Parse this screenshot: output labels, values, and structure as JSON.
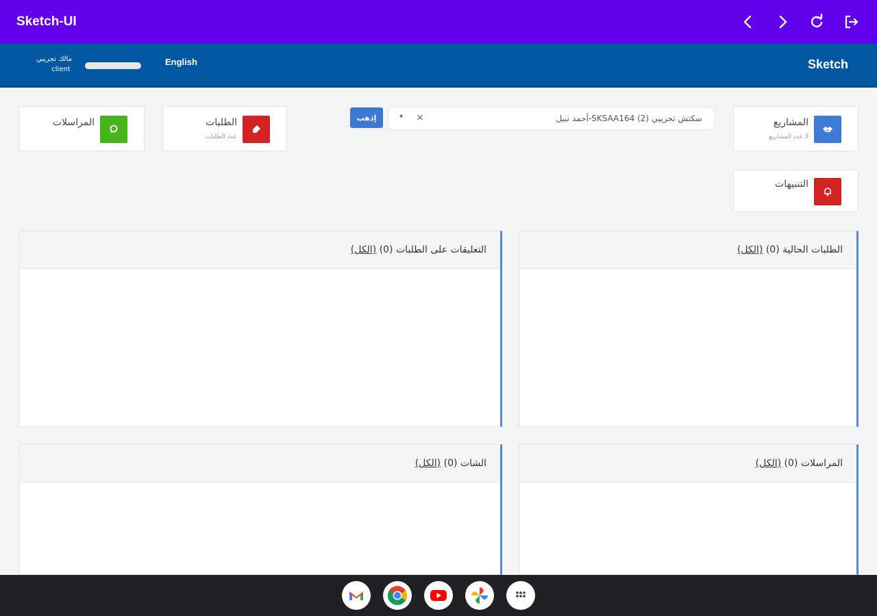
{
  "appbar": {
    "title": "Sketch-UI",
    "actions": [
      {
        "name": "back-button",
        "icon": "chevron-left-icon"
      },
      {
        "name": "forward-button",
        "icon": "chevron-right-icon"
      },
      {
        "name": "reload-button",
        "icon": "refresh-icon"
      },
      {
        "name": "logout-button",
        "icon": "logout-icon"
      }
    ],
    "colors": {
      "background": "#6200ee"
    }
  },
  "header": {
    "brand": "Sketch",
    "language_link": "English",
    "user": {
      "name": "مالك تجريبي",
      "role": "client"
    },
    "colors": {
      "background": "#0158a0"
    }
  },
  "cards": {
    "projects": {
      "label": "المشاريع",
      "sub": "لا عدد المشاريع",
      "icon": "handshake-icon",
      "color": "#3e7bd6"
    },
    "requests": {
      "label": "الطلبات",
      "sub": "عدد الطلبات",
      "icon": "tag-icon",
      "color": "#d32224"
    },
    "messages": {
      "label": "المراسلات",
      "sub": "",
      "icon": "chat-bubble-icon",
      "color": "#46b41a"
    },
    "alerts": {
      "label": "التنبيهات",
      "sub": "",
      "icon": "bell-icon",
      "color": "#d32224"
    }
  },
  "project_select": {
    "value": "سكتش تجريبي (2) SKSAA164-أحمد نبيل",
    "clear_symbol": "×",
    "arrow_symbol": "▾",
    "go_label": "إذهب"
  },
  "panels": {
    "current_requests": {
      "title": "الطلبات الحالية",
      "count": "(0)",
      "all_link": "(الكل)"
    },
    "request_comments": {
      "title": "التعليقات على الطلبات",
      "count": "(0)",
      "all_link": "(الكل)"
    },
    "correspondence": {
      "title": "المراسلات",
      "count": "(0)",
      "all_link": "(الكل)"
    },
    "chat": {
      "title": "الشات",
      "count": "(0)",
      "all_link": "(الكل)"
    }
  },
  "taskbar": {
    "apps": [
      "gmail-icon",
      "chrome-icon",
      "youtube-icon",
      "photos-icon",
      "app-launcher-icon"
    ]
  }
}
